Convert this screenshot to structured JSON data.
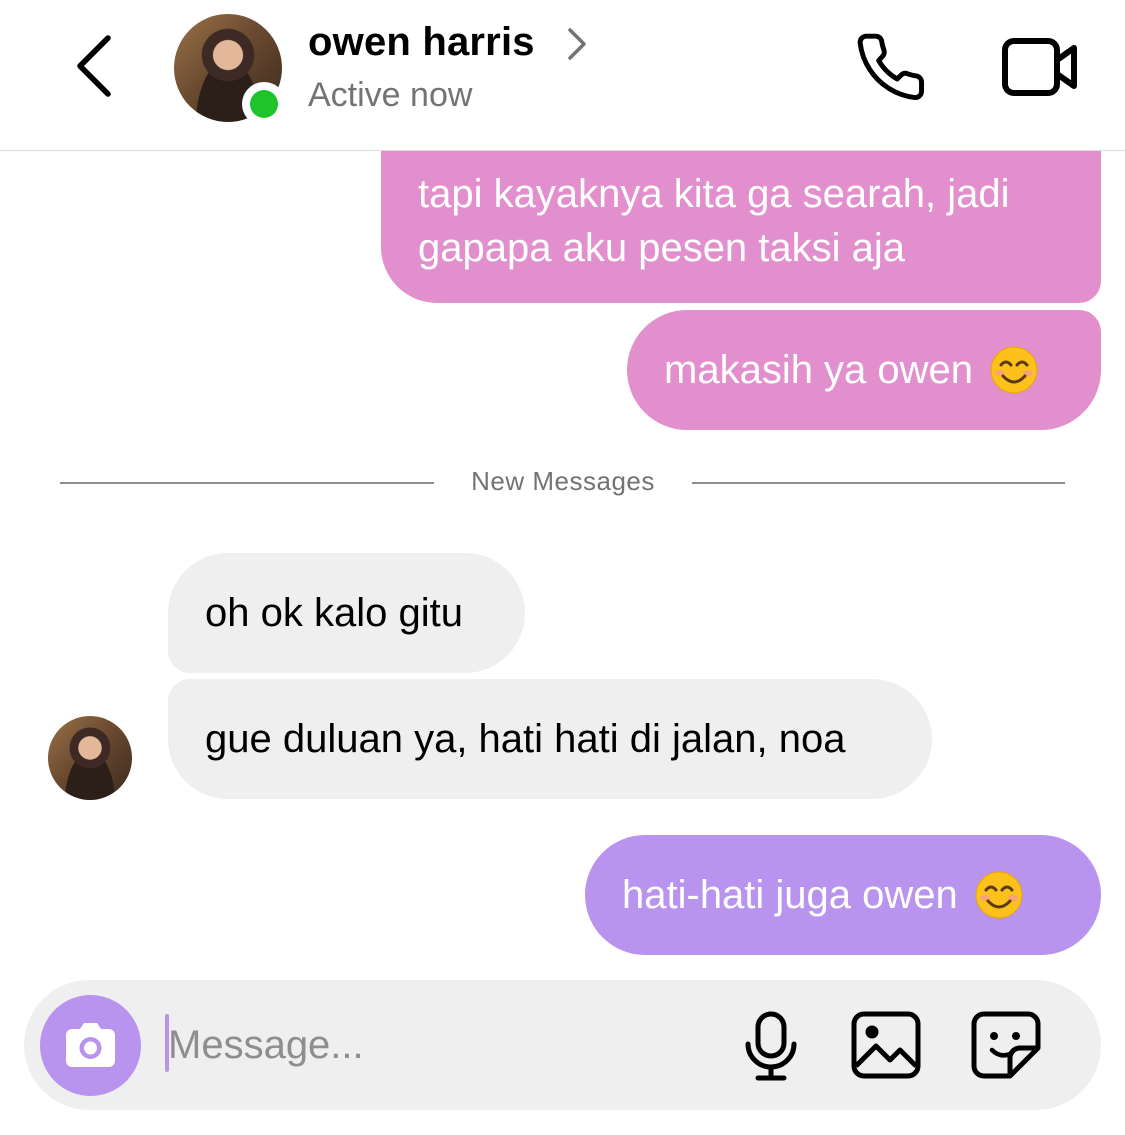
{
  "header": {
    "contact_name": "owen harris",
    "status": "Active now",
    "icons": [
      "back-chevron-icon",
      "avatar",
      "online-indicator",
      "chevron-right-icon",
      "phone-icon",
      "video-camera-icon"
    ],
    "online_color": "#1ec42a"
  },
  "messages": [
    {
      "from": "me",
      "text": "tapi kayaknya kita ga searah, jadi gapapa aku pesen taksi aja",
      "color": "#e28fcd"
    },
    {
      "from": "me",
      "text": "makasih ya owen",
      "emoji": "smiling-face-emoji",
      "color": "#e28fcd"
    },
    {
      "from": "owen",
      "text": "oh ok kalo gitu"
    },
    {
      "from": "owen",
      "text": "gue duluan ya, hati hati di jalan, noa"
    },
    {
      "from": "me",
      "text": "hati-hati juga owen",
      "emoji": "smiling-face-emoji",
      "color": "#b894ee"
    }
  ],
  "divider": {
    "label": "New Messages"
  },
  "composer": {
    "placeholder": "Message...",
    "icons": [
      "camera-icon",
      "microphone-icon",
      "image-gallery-icon",
      "sticker-icon"
    ],
    "accent": "#b894ee"
  }
}
